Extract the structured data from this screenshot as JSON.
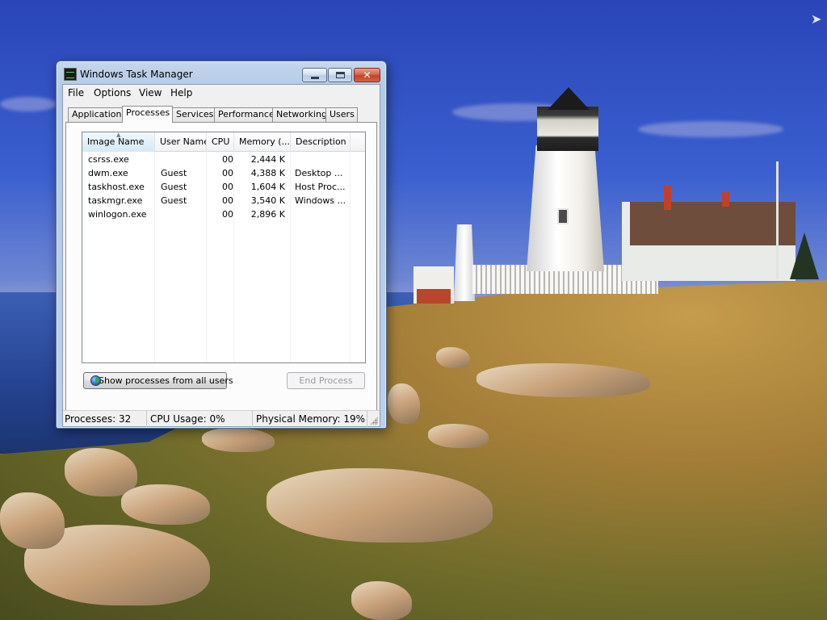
{
  "window": {
    "title": "Windows Task Manager",
    "controls": {
      "minimize": "",
      "maximize": "",
      "close": "✕"
    }
  },
  "menu": [
    "File",
    "Options",
    "View",
    "Help"
  ],
  "tabs": [
    {
      "label": "Applications",
      "active": false
    },
    {
      "label": "Processes",
      "active": true
    },
    {
      "label": "Services",
      "active": false
    },
    {
      "label": "Performance",
      "active": false
    },
    {
      "label": "Networking",
      "active": false
    },
    {
      "label": "Users",
      "active": false
    }
  ],
  "processes": {
    "columns": [
      "Image Name",
      "User Name",
      "CPU",
      "Memory (...",
      "Description"
    ],
    "sorted_column": "Image Name",
    "rows": [
      {
        "name": "csrss.exe",
        "user": "",
        "cpu": "00",
        "memory": "2,444 K",
        "description": ""
      },
      {
        "name": "dwm.exe",
        "user": "Guest",
        "cpu": "00",
        "memory": "4,388 K",
        "description": "Desktop ..."
      },
      {
        "name": "taskhost.exe",
        "user": "Guest",
        "cpu": "00",
        "memory": "1,604 K",
        "description": "Host Proc..."
      },
      {
        "name": "taskmgr.exe",
        "user": "Guest",
        "cpu": "00",
        "memory": "3,540 K",
        "description": "Windows ..."
      },
      {
        "name": "winlogon.exe",
        "user": "",
        "cpu": "00",
        "memory": "2,896 K",
        "description": ""
      }
    ]
  },
  "buttons": {
    "show_all": "Show processes from all users",
    "end_process": "End Process"
  },
  "status": {
    "processes": "Processes: 32",
    "cpu": "CPU Usage: 0%",
    "memory": "Physical Memory: 19%"
  },
  "colors": {
    "titlebar": "#b3c9e6",
    "close_button": "#c0412a",
    "selected_tab": "#fcfcfc",
    "sorted_column": "#e3f0f9"
  },
  "icons": {
    "app": "task-manager-icon",
    "show_all": "globe-shield-icon",
    "desktop_cursor": "arrow-icon"
  }
}
